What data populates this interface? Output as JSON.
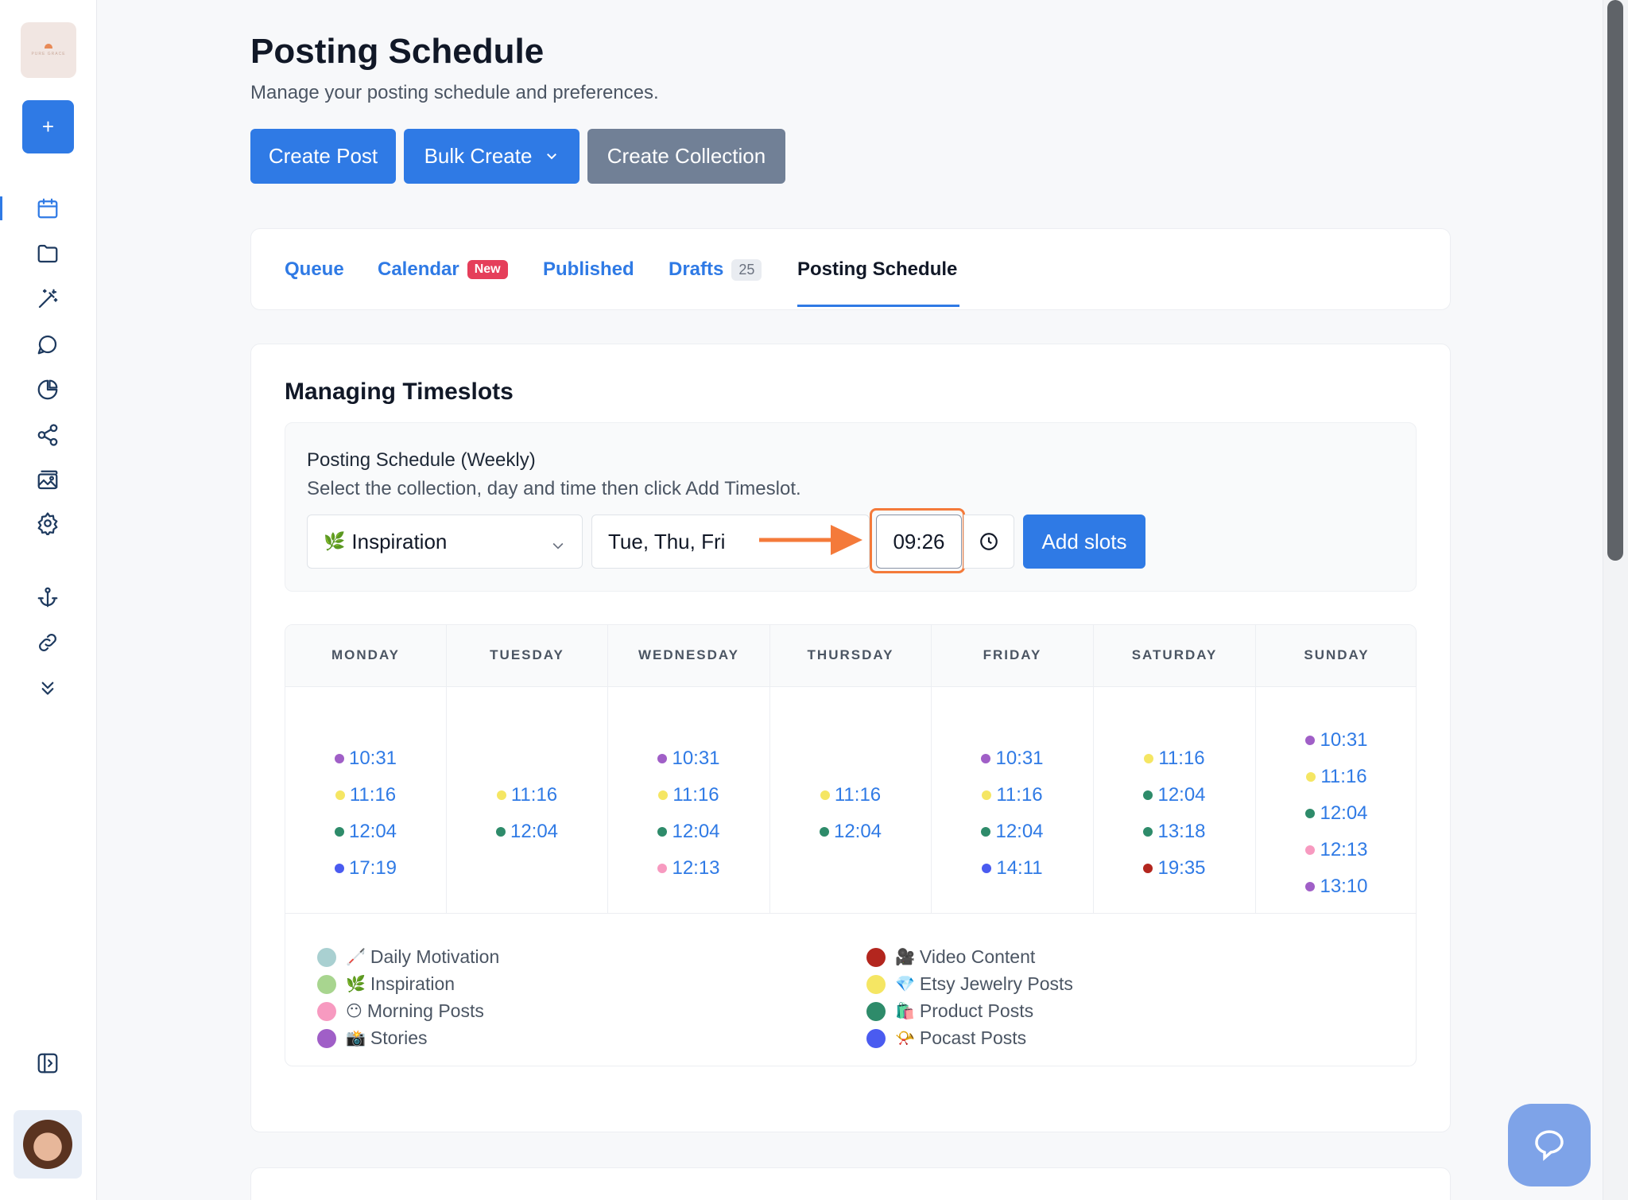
{
  "sidebar": {
    "logo_text": "PURE GRACE",
    "new_label": "+"
  },
  "header": {
    "title": "Posting Schedule",
    "subtitle": "Manage your posting schedule and preferences."
  },
  "actions": {
    "create_post": "Create Post",
    "bulk_create": "Bulk Create",
    "create_collection": "Create Collection"
  },
  "tabs": [
    {
      "label": "Queue"
    },
    {
      "label": "Calendar",
      "badge": "New"
    },
    {
      "label": "Published"
    },
    {
      "label": "Drafts",
      "count": "25"
    },
    {
      "label": "Posting Schedule"
    }
  ],
  "timeslots": {
    "title": "Managing Timeslots",
    "form_label": "Posting Schedule (Weekly)",
    "form_help": "Select the collection, day and time then click Add Timeslot.",
    "collection_emoji": "🌿",
    "collection_value": "Inspiration",
    "days_value": "Tue, Thu, Fri",
    "time_value": "09:26",
    "add_button": "Add slots"
  },
  "schedule": {
    "days": [
      "MONDAY",
      "TUESDAY",
      "WEDNESDAY",
      "THURSDAY",
      "FRIDAY",
      "SATURDAY",
      "SUNDAY"
    ],
    "slots": [
      [
        {
          "time": "10:31",
          "color": "#a05fc7"
        },
        {
          "time": "11:16",
          "color": "#f5e663"
        },
        {
          "time": "12:04",
          "color": "#2e8b6a"
        },
        {
          "time": "17:19",
          "color": "#4a5bf0"
        }
      ],
      [
        {
          "time": "11:16",
          "color": "#f5e663"
        },
        {
          "time": "12:04",
          "color": "#2e8b6a"
        }
      ],
      [
        {
          "time": "10:31",
          "color": "#a05fc7"
        },
        {
          "time": "11:16",
          "color": "#f5e663"
        },
        {
          "time": "12:04",
          "color": "#2e8b6a"
        },
        {
          "time": "12:13",
          "color": "#f79ac0"
        }
      ],
      [
        {
          "time": "11:16",
          "color": "#f5e663"
        },
        {
          "time": "12:04",
          "color": "#2e8b6a"
        }
      ],
      [
        {
          "time": "10:31",
          "color": "#a05fc7"
        },
        {
          "time": "11:16",
          "color": "#f5e663"
        },
        {
          "time": "12:04",
          "color": "#2e8b6a"
        },
        {
          "time": "14:11",
          "color": "#4a5bf0"
        }
      ],
      [
        {
          "time": "11:16",
          "color": "#f5e663"
        },
        {
          "time": "12:04",
          "color": "#2e8b6a"
        },
        {
          "time": "13:18",
          "color": "#2e8b6a"
        },
        {
          "time": "19:35",
          "color": "#b3261e"
        }
      ],
      [
        {
          "time": "10:31",
          "color": "#a05fc7"
        },
        {
          "time": "11:16",
          "color": "#f5e663"
        },
        {
          "time": "12:04",
          "color": "#2e8b6a"
        },
        {
          "time": "12:13",
          "color": "#f79ac0"
        },
        {
          "time": "13:10",
          "color": "#a05fc7"
        }
      ]
    ]
  },
  "legend": [
    {
      "emoji": "🦯",
      "label": "Daily Motivation",
      "color": "#a9d0d1"
    },
    {
      "emoji": "🌿",
      "label": "Inspiration",
      "color": "#a8d58f"
    },
    {
      "emoji": "😶",
      "label": "Morning Posts",
      "color": "#f79ac0"
    },
    {
      "emoji": "📸",
      "label": "Stories",
      "color": "#a05fc7"
    },
    {
      "emoji": "🎥",
      "label": "Video Content",
      "color": "#b3261e"
    },
    {
      "emoji": "💎",
      "label": "Etsy Jewelry Posts",
      "color": "#f5e663"
    },
    {
      "emoji": "🛍️",
      "label": "Product Posts",
      "color": "#2e8b6a"
    },
    {
      "emoji": "📯",
      "label": "Pocast Posts",
      "color": "#4a5bf0"
    }
  ],
  "colors": {
    "accent": "#2f7ae5",
    "highlight": "#f47a3a",
    "secondary_button": "#718096"
  }
}
